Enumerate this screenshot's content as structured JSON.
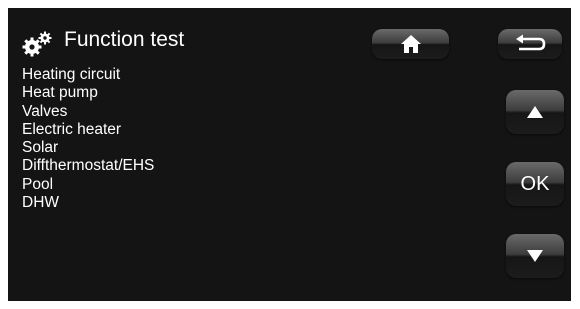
{
  "header": {
    "title": "Function test",
    "app_icon": "gears-icon"
  },
  "menu": {
    "items": [
      "Heating circuit",
      "Heat pump",
      "Valves",
      "Electric heater",
      "Solar",
      "Diffthermostat/EHS",
      "Pool",
      "DHW"
    ]
  },
  "buttons": {
    "home_icon": "home-icon",
    "back_icon": "back-arrow-icon",
    "up_icon": "arrow-up-icon",
    "ok_label": "OK",
    "down_icon": "arrow-down-icon"
  }
}
